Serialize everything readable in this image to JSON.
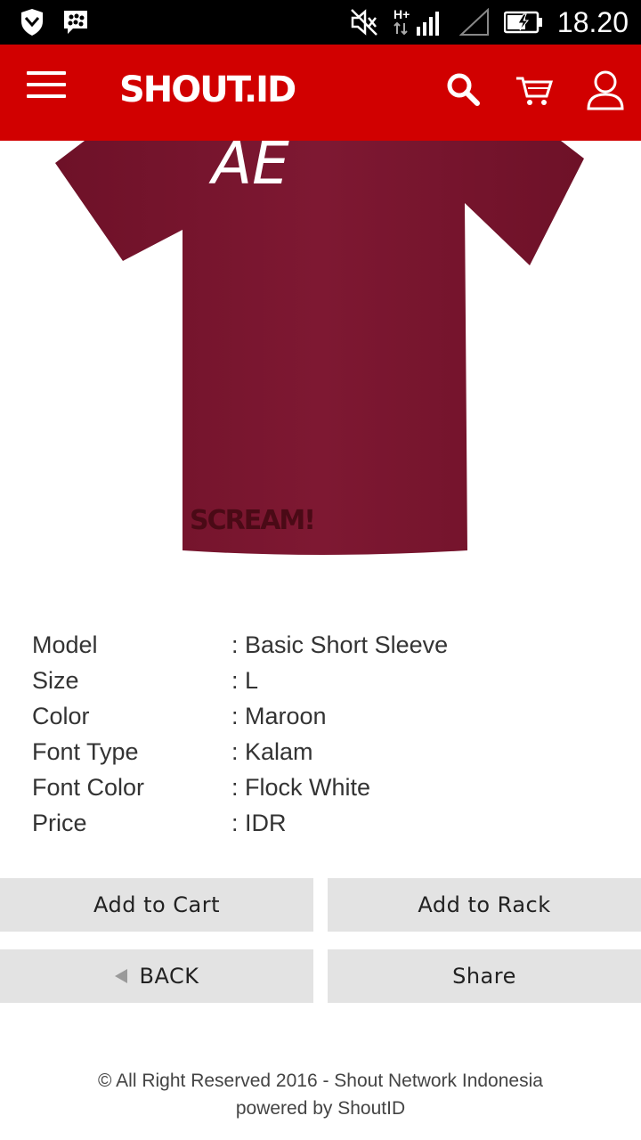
{
  "status_bar": {
    "time": "18.20",
    "network": "H+",
    "icons": [
      "shield-icon",
      "bbm-icon",
      "mute-icon",
      "signal-icon",
      "no-signal-icon",
      "battery-charging-icon"
    ]
  },
  "header": {
    "logo": "SHOUT.ID",
    "icons": [
      "menu-icon",
      "search-icon",
      "cart-icon",
      "user-icon"
    ],
    "color": "#d10000"
  },
  "product": {
    "shirt_color": "#7a1530",
    "front_text": "AE",
    "print_text": "SCREAM!"
  },
  "details": [
    {
      "label": "Model",
      "value": ": Basic Short Sleeve"
    },
    {
      "label": "Size",
      "value": ": L"
    },
    {
      "label": "Color",
      "value": ": Maroon"
    },
    {
      "label": "Font Type",
      "value": ": Kalam"
    },
    {
      "label": "Font Color",
      "value": ": Flock White"
    },
    {
      "label": "Price",
      "value": ": IDR"
    }
  ],
  "buttons": {
    "add_to_cart": "Add to Cart",
    "add_to_rack": "Add to Rack",
    "back": "BACK",
    "share": "Share"
  },
  "footer": {
    "copyright": "© All Right Reserved 2016 - Shout Network Indonesia",
    "powered": "powered by ShoutID"
  }
}
